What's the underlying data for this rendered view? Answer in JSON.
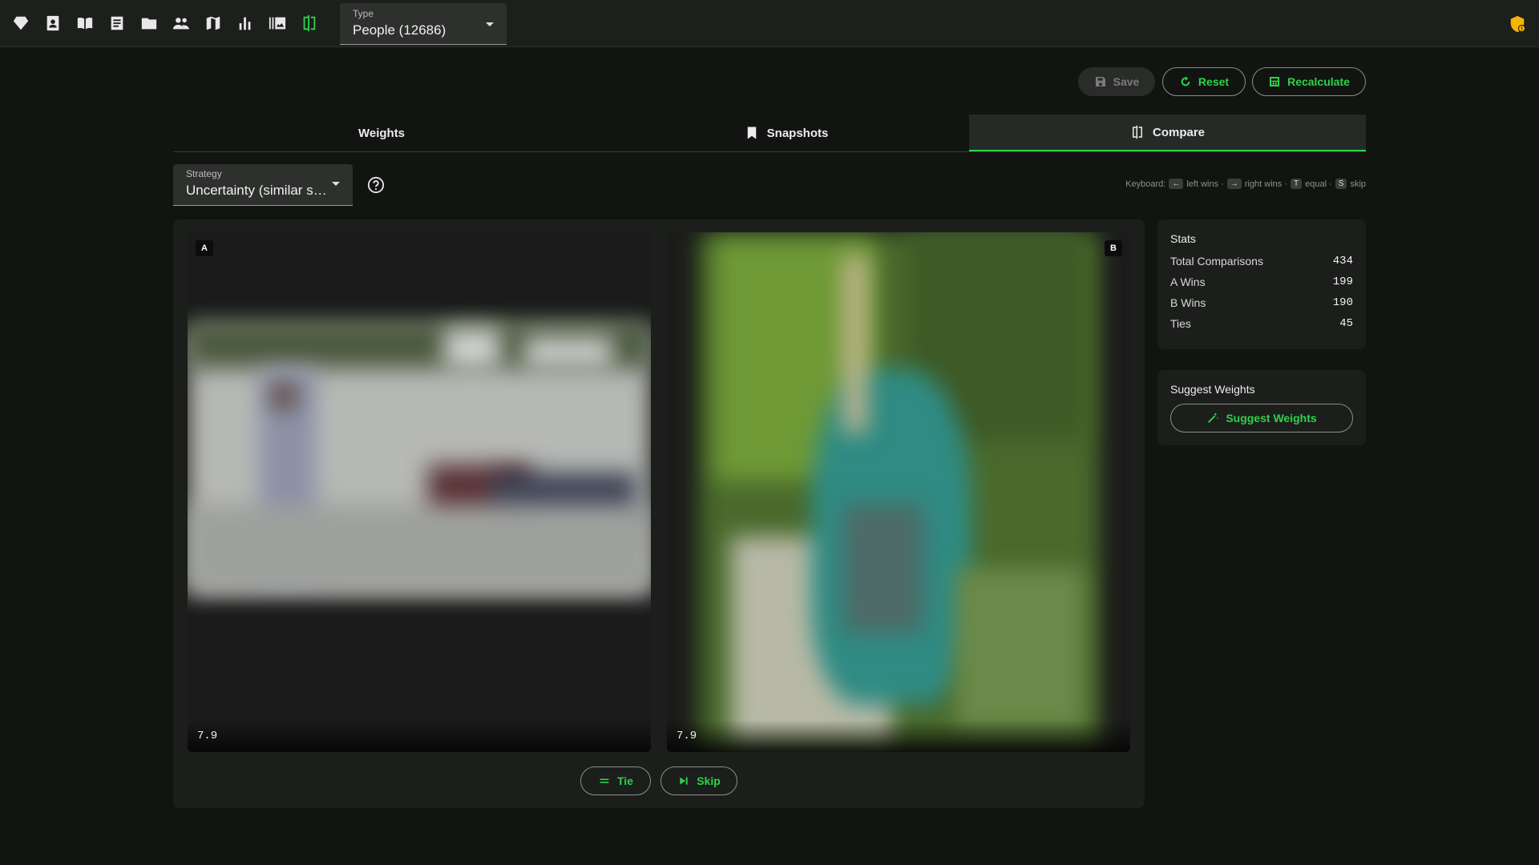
{
  "topbar": {
    "nav_icons": [
      "diamond-icon",
      "contact-card-icon",
      "open-book-icon",
      "article-icon",
      "folder-icon",
      "people-icon",
      "map-icon",
      "bar-chart-icon",
      "image-gallery-icon",
      "compare-icon"
    ],
    "active_icon": "compare-icon",
    "type_select": {
      "label": "Type",
      "value": "People (12686)"
    },
    "right_icon": "shield-alert-icon"
  },
  "actions": {
    "save": "Save",
    "reset": "Reset",
    "recalculate": "Recalculate"
  },
  "tabs": [
    {
      "label": "Weights",
      "icon": ""
    },
    {
      "label": "Snapshots",
      "icon": "bookmark-icon"
    },
    {
      "label": "Compare",
      "icon": "compare-icon"
    }
  ],
  "active_tab": "Compare",
  "strategy": {
    "label": "Strategy",
    "value": "Uncertainty (similar sc…"
  },
  "keyboard": {
    "prefix": "Keyboard:",
    "left_key": "←",
    "left_text": "left wins ·",
    "right_key": "→",
    "right_text": "right wins ·",
    "tie_key": "T",
    "tie_text": "equal ·",
    "skip_key": "S",
    "skip_text": "skip"
  },
  "compare": {
    "a": {
      "badge": "A",
      "score": "7.9"
    },
    "b": {
      "badge": "B",
      "score": "7.9"
    },
    "tie_label": "Tie",
    "skip_label": "Skip"
  },
  "stats": {
    "title": "Stats",
    "rows": [
      {
        "label": "Total Comparisons",
        "value": "434"
      },
      {
        "label": "A Wins",
        "value": "199"
      },
      {
        "label": "B Wins",
        "value": "190"
      },
      {
        "label": "Ties",
        "value": "45"
      }
    ]
  },
  "suggest": {
    "title": "Suggest Weights",
    "button": "Suggest Weights"
  },
  "colors": {
    "accent": "#2ed14a",
    "background": "#121412",
    "panel": "#1c1e1c",
    "warning": "#f4b400"
  }
}
